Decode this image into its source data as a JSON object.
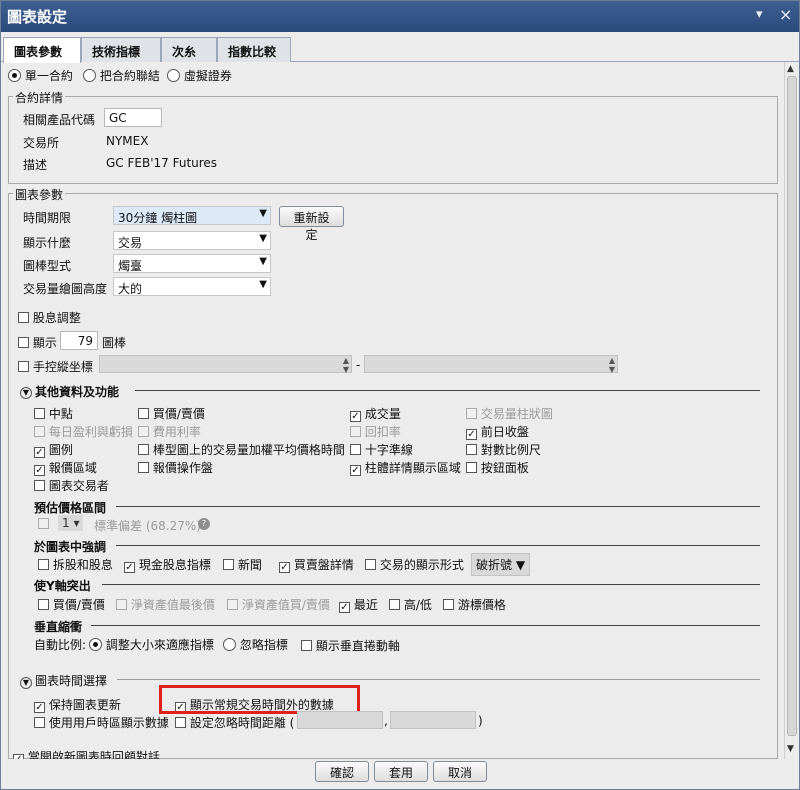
{
  "window": {
    "title": "圖表設定",
    "pin_glyph": "▾",
    "close_glyph": "×"
  },
  "tabs": [
    "圖表參數",
    "技術指標",
    "次糸",
    "指數比較"
  ],
  "contract_mode": {
    "options": [
      "單一合約",
      "把合約聯結",
      "虛擬證券"
    ],
    "selected": "單一合約"
  },
  "contract_details": {
    "title": "合約詳情",
    "symbol_label": "相關產品代碼",
    "symbol_value": "GC",
    "exchange_label": "交易所",
    "exchange_value": "NYMEX",
    "desc_label": "描述",
    "desc_value": "GC FEB'17 Futures"
  },
  "chart_params": {
    "title": "圖表參數",
    "period_label": "時間期限",
    "period_value": "30分鐘 燭柱圖",
    "reset_button": "重新設定",
    "show_label": "顯示什麼",
    "show_value": "交易",
    "bar_type_label": "圖棒型式",
    "bar_type_value": "燭臺",
    "volume_height_label": "交易量繪圖高度",
    "volume_height_value": "大的",
    "dividend_adjust": "股息調整",
    "show_prefix": "顯示",
    "show_bars_count": "79",
    "show_suffix": "圖棒",
    "manual_axis": "手控縱坐標",
    "range_dash": "-"
  },
  "other_data": {
    "title": "其他資料及功能",
    "items": [
      {
        "label": "中點",
        "checked": false,
        "enabled": true
      },
      {
        "label": "買價/賣價",
        "checked": false,
        "enabled": true
      },
      {
        "label": "成交量",
        "checked": true,
        "enabled": true
      },
      {
        "label": "交易量柱狀圖",
        "checked": false,
        "enabled": false
      },
      {
        "label": "每日盈利與虧損",
        "checked": false,
        "enabled": false
      },
      {
        "label": "費用利率",
        "checked": false,
        "enabled": false
      },
      {
        "label": "回扣率",
        "checked": false,
        "enabled": false
      },
      {
        "label": "前日收盤",
        "checked": true,
        "enabled": true
      },
      {
        "label": "圖例",
        "checked": true,
        "enabled": true
      },
      {
        "label": "棒型圖上的交易量加權平均價格時間",
        "checked": false,
        "enabled": true
      },
      {
        "label": "十字準線",
        "checked": false,
        "enabled": true
      },
      {
        "label": "對數比例尺",
        "checked": false,
        "enabled": true
      },
      {
        "label": "報價區域",
        "checked": true,
        "enabled": true
      },
      {
        "label": "報價操作盤",
        "checked": false,
        "enabled": true
      },
      {
        "label": "柱體詳情顯示區域",
        "checked": true,
        "enabled": true
      },
      {
        "label": "按鈕面板",
        "checked": false,
        "enabled": true
      },
      {
        "label": "圖表交易者",
        "checked": false,
        "enabled": true
      }
    ]
  },
  "forecast": {
    "title": "預估價格區間",
    "count": "1",
    "label": "標準偏差 (68.27%)",
    "help_icon": "?"
  },
  "emphasize": {
    "title": "於圖表中強調",
    "items": [
      {
        "label": "拆股和股息",
        "checked": false
      },
      {
        "label": "現金股息指標",
        "checked": true
      },
      {
        "label": "新聞",
        "checked": false
      },
      {
        "label": "買賣盤詳情",
        "checked": true
      },
      {
        "label": "交易的顯示形式",
        "checked": false
      }
    ],
    "display_form_value": "破折號"
  },
  "y_axis": {
    "title": "使Y軸突出",
    "items": [
      {
        "label": "買價/賣價",
        "checked": false,
        "enabled": true
      },
      {
        "label": "淨資產值最後價",
        "checked": false,
        "enabled": false
      },
      {
        "label": "淨資產值買/賣價",
        "checked": false,
        "enabled": false
      },
      {
        "label": "最近",
        "checked": true,
        "enabled": true
      },
      {
        "label": "高/低",
        "checked": false,
        "enabled": true
      },
      {
        "label": "游標價格",
        "checked": false,
        "enabled": true
      }
    ]
  },
  "vertical_scale": {
    "title": "垂直縮衝",
    "auto_label": "自動比例:",
    "option_fit": "調整大小來適應指標",
    "option_ignore": "忽略指標",
    "option_ignore_selected": false,
    "fit_selected": true,
    "scroll_label": "顯示垂直捲動軸"
  },
  "time_selection": {
    "title": "圖表時間選擇",
    "keep_update": "保持圖表更新",
    "keep_update_checked": true,
    "outside_hours": "顯示常規交易時間外的數據",
    "outside_hours_checked": true,
    "user_timezone": "使用用戶時區顯示數據",
    "ignore_time": "設定忽略時間距離 (",
    "comma": ",",
    "close_paren": ")"
  },
  "footer_check": "當開啟新圖表時回顧對話",
  "buttons": {
    "ok": "確認",
    "apply": "套用",
    "cancel": "取消"
  }
}
